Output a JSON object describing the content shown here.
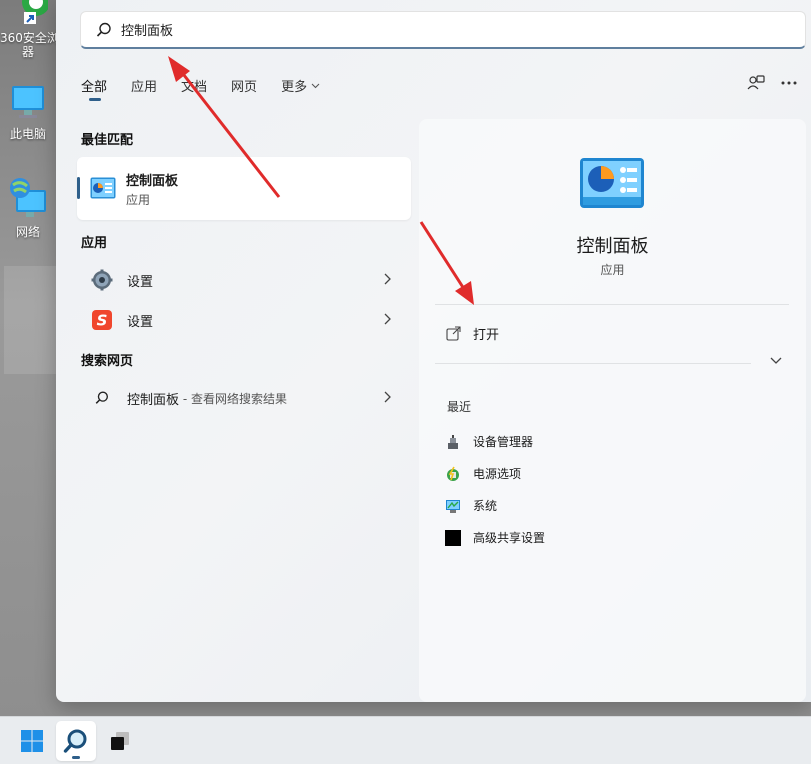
{
  "desktop": {
    "icons": [
      {
        "label": "360安全浏览器",
        "display": "360安全浏\n器",
        "icon": "360-browser-icon"
      },
      {
        "label": "此电脑",
        "display": "此电脑",
        "icon": "computer-icon"
      },
      {
        "label": "网络",
        "display": "网络",
        "icon": "network-icon"
      }
    ]
  },
  "search": {
    "query": "控制面板",
    "icon": "search-icon"
  },
  "filters": {
    "items": [
      "全部",
      "应用",
      "文档",
      "网页"
    ],
    "more_label": "更多",
    "active": "全部"
  },
  "best_match": {
    "heading": "最佳匹配",
    "title": "控制面板",
    "subtitle": "应用",
    "icon": "control-panel-icon"
  },
  "apps": {
    "heading": "应用",
    "items": [
      {
        "label": "设置",
        "icon": "gear-icon"
      },
      {
        "label": "设置",
        "icon": "sogou-icon"
      }
    ]
  },
  "web": {
    "heading": "搜索网页",
    "query": "控制面板",
    "suffix": " - 查看网络搜索结果",
    "icon": "search-icon"
  },
  "detail": {
    "title": "控制面板",
    "subtitle": "应用",
    "open_label": "打开",
    "recent_heading": "最近",
    "recent": [
      {
        "label": "设备管理器",
        "icon": "device-manager-icon"
      },
      {
        "label": "电源选项",
        "icon": "power-options-icon"
      },
      {
        "label": "系统",
        "icon": "system-icon"
      },
      {
        "label": "高级共享设置",
        "icon": "sharing-settings-icon"
      }
    ]
  },
  "taskbar": {
    "items": [
      "start-icon",
      "search-icon",
      "task-view-icon"
    ]
  },
  "colors": {
    "accent": "#2e5f8a",
    "annotation_arrow": "#e02b2b"
  }
}
